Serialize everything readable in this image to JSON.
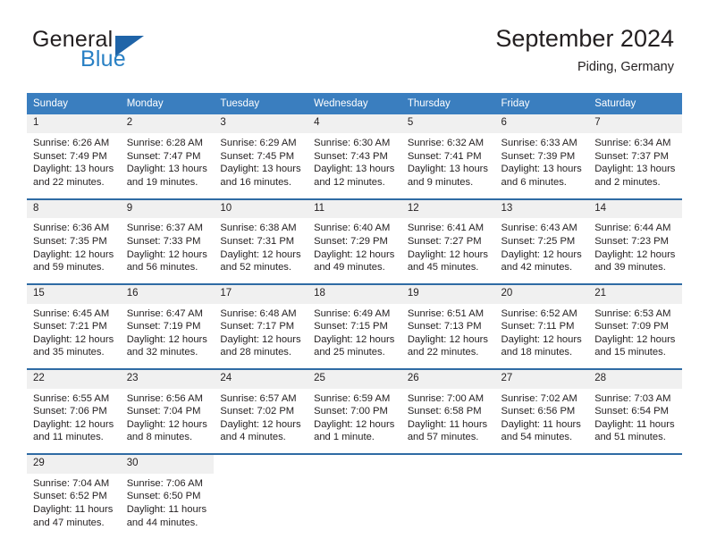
{
  "brand": {
    "name_part1": "General",
    "name_part2": "Blue",
    "triangle_color": "#1f64a8",
    "blue_text_color": "#2980c4"
  },
  "header": {
    "title": "September 2024",
    "subtitle": "Piding, Germany"
  },
  "theme": {
    "header_blue": "#3a7ebf",
    "rule_blue": "#2f6ba4",
    "daynum_band": "#f0f0f0",
    "text": "#231f20"
  },
  "weekday_headers": [
    "Sunday",
    "Monday",
    "Tuesday",
    "Wednesday",
    "Thursday",
    "Friday",
    "Saturday"
  ],
  "weeks": [
    [
      {
        "day": "1",
        "sunrise": "Sunrise: 6:26 AM",
        "sunset": "Sunset: 7:49 PM",
        "daylight1": "Daylight: 13 hours",
        "daylight2": "and 22 minutes."
      },
      {
        "day": "2",
        "sunrise": "Sunrise: 6:28 AM",
        "sunset": "Sunset: 7:47 PM",
        "daylight1": "Daylight: 13 hours",
        "daylight2": "and 19 minutes."
      },
      {
        "day": "3",
        "sunrise": "Sunrise: 6:29 AM",
        "sunset": "Sunset: 7:45 PM",
        "daylight1": "Daylight: 13 hours",
        "daylight2": "and 16 minutes."
      },
      {
        "day": "4",
        "sunrise": "Sunrise: 6:30 AM",
        "sunset": "Sunset: 7:43 PM",
        "daylight1": "Daylight: 13 hours",
        "daylight2": "and 12 minutes."
      },
      {
        "day": "5",
        "sunrise": "Sunrise: 6:32 AM",
        "sunset": "Sunset: 7:41 PM",
        "daylight1": "Daylight: 13 hours",
        "daylight2": "and 9 minutes."
      },
      {
        "day": "6",
        "sunrise": "Sunrise: 6:33 AM",
        "sunset": "Sunset: 7:39 PM",
        "daylight1": "Daylight: 13 hours",
        "daylight2": "and 6 minutes."
      },
      {
        "day": "7",
        "sunrise": "Sunrise: 6:34 AM",
        "sunset": "Sunset: 7:37 PM",
        "daylight1": "Daylight: 13 hours",
        "daylight2": "and 2 minutes."
      }
    ],
    [
      {
        "day": "8",
        "sunrise": "Sunrise: 6:36 AM",
        "sunset": "Sunset: 7:35 PM",
        "daylight1": "Daylight: 12 hours",
        "daylight2": "and 59 minutes."
      },
      {
        "day": "9",
        "sunrise": "Sunrise: 6:37 AM",
        "sunset": "Sunset: 7:33 PM",
        "daylight1": "Daylight: 12 hours",
        "daylight2": "and 56 minutes."
      },
      {
        "day": "10",
        "sunrise": "Sunrise: 6:38 AM",
        "sunset": "Sunset: 7:31 PM",
        "daylight1": "Daylight: 12 hours",
        "daylight2": "and 52 minutes."
      },
      {
        "day": "11",
        "sunrise": "Sunrise: 6:40 AM",
        "sunset": "Sunset: 7:29 PM",
        "daylight1": "Daylight: 12 hours",
        "daylight2": "and 49 minutes."
      },
      {
        "day": "12",
        "sunrise": "Sunrise: 6:41 AM",
        "sunset": "Sunset: 7:27 PM",
        "daylight1": "Daylight: 12 hours",
        "daylight2": "and 45 minutes."
      },
      {
        "day": "13",
        "sunrise": "Sunrise: 6:43 AM",
        "sunset": "Sunset: 7:25 PM",
        "daylight1": "Daylight: 12 hours",
        "daylight2": "and 42 minutes."
      },
      {
        "day": "14",
        "sunrise": "Sunrise: 6:44 AM",
        "sunset": "Sunset: 7:23 PM",
        "daylight1": "Daylight: 12 hours",
        "daylight2": "and 39 minutes."
      }
    ],
    [
      {
        "day": "15",
        "sunrise": "Sunrise: 6:45 AM",
        "sunset": "Sunset: 7:21 PM",
        "daylight1": "Daylight: 12 hours",
        "daylight2": "and 35 minutes."
      },
      {
        "day": "16",
        "sunrise": "Sunrise: 6:47 AM",
        "sunset": "Sunset: 7:19 PM",
        "daylight1": "Daylight: 12 hours",
        "daylight2": "and 32 minutes."
      },
      {
        "day": "17",
        "sunrise": "Sunrise: 6:48 AM",
        "sunset": "Sunset: 7:17 PM",
        "daylight1": "Daylight: 12 hours",
        "daylight2": "and 28 minutes."
      },
      {
        "day": "18",
        "sunrise": "Sunrise: 6:49 AM",
        "sunset": "Sunset: 7:15 PM",
        "daylight1": "Daylight: 12 hours",
        "daylight2": "and 25 minutes."
      },
      {
        "day": "19",
        "sunrise": "Sunrise: 6:51 AM",
        "sunset": "Sunset: 7:13 PM",
        "daylight1": "Daylight: 12 hours",
        "daylight2": "and 22 minutes."
      },
      {
        "day": "20",
        "sunrise": "Sunrise: 6:52 AM",
        "sunset": "Sunset: 7:11 PM",
        "daylight1": "Daylight: 12 hours",
        "daylight2": "and 18 minutes."
      },
      {
        "day": "21",
        "sunrise": "Sunrise: 6:53 AM",
        "sunset": "Sunset: 7:09 PM",
        "daylight1": "Daylight: 12 hours",
        "daylight2": "and 15 minutes."
      }
    ],
    [
      {
        "day": "22",
        "sunrise": "Sunrise: 6:55 AM",
        "sunset": "Sunset: 7:06 PM",
        "daylight1": "Daylight: 12 hours",
        "daylight2": "and 11 minutes."
      },
      {
        "day": "23",
        "sunrise": "Sunrise: 6:56 AM",
        "sunset": "Sunset: 7:04 PM",
        "daylight1": "Daylight: 12 hours",
        "daylight2": "and 8 minutes."
      },
      {
        "day": "24",
        "sunrise": "Sunrise: 6:57 AM",
        "sunset": "Sunset: 7:02 PM",
        "daylight1": "Daylight: 12 hours",
        "daylight2": "and 4 minutes."
      },
      {
        "day": "25",
        "sunrise": "Sunrise: 6:59 AM",
        "sunset": "Sunset: 7:00 PM",
        "daylight1": "Daylight: 12 hours",
        "daylight2": "and 1 minute."
      },
      {
        "day": "26",
        "sunrise": "Sunrise: 7:00 AM",
        "sunset": "Sunset: 6:58 PM",
        "daylight1": "Daylight: 11 hours",
        "daylight2": "and 57 minutes."
      },
      {
        "day": "27",
        "sunrise": "Sunrise: 7:02 AM",
        "sunset": "Sunset: 6:56 PM",
        "daylight1": "Daylight: 11 hours",
        "daylight2": "and 54 minutes."
      },
      {
        "day": "28",
        "sunrise": "Sunrise: 7:03 AM",
        "sunset": "Sunset: 6:54 PM",
        "daylight1": "Daylight: 11 hours",
        "daylight2": "and 51 minutes."
      }
    ],
    [
      {
        "day": "29",
        "sunrise": "Sunrise: 7:04 AM",
        "sunset": "Sunset: 6:52 PM",
        "daylight1": "Daylight: 11 hours",
        "daylight2": "and 47 minutes."
      },
      {
        "day": "30",
        "sunrise": "Sunrise: 7:06 AM",
        "sunset": "Sunset: 6:50 PM",
        "daylight1": "Daylight: 11 hours",
        "daylight2": "and 44 minutes."
      },
      {
        "day": "",
        "sunrise": "",
        "sunset": "",
        "daylight1": "",
        "daylight2": ""
      },
      {
        "day": "",
        "sunrise": "",
        "sunset": "",
        "daylight1": "",
        "daylight2": ""
      },
      {
        "day": "",
        "sunrise": "",
        "sunset": "",
        "daylight1": "",
        "daylight2": ""
      },
      {
        "day": "",
        "sunrise": "",
        "sunset": "",
        "daylight1": "",
        "daylight2": ""
      },
      {
        "day": "",
        "sunrise": "",
        "sunset": "",
        "daylight1": "",
        "daylight2": ""
      }
    ]
  ]
}
